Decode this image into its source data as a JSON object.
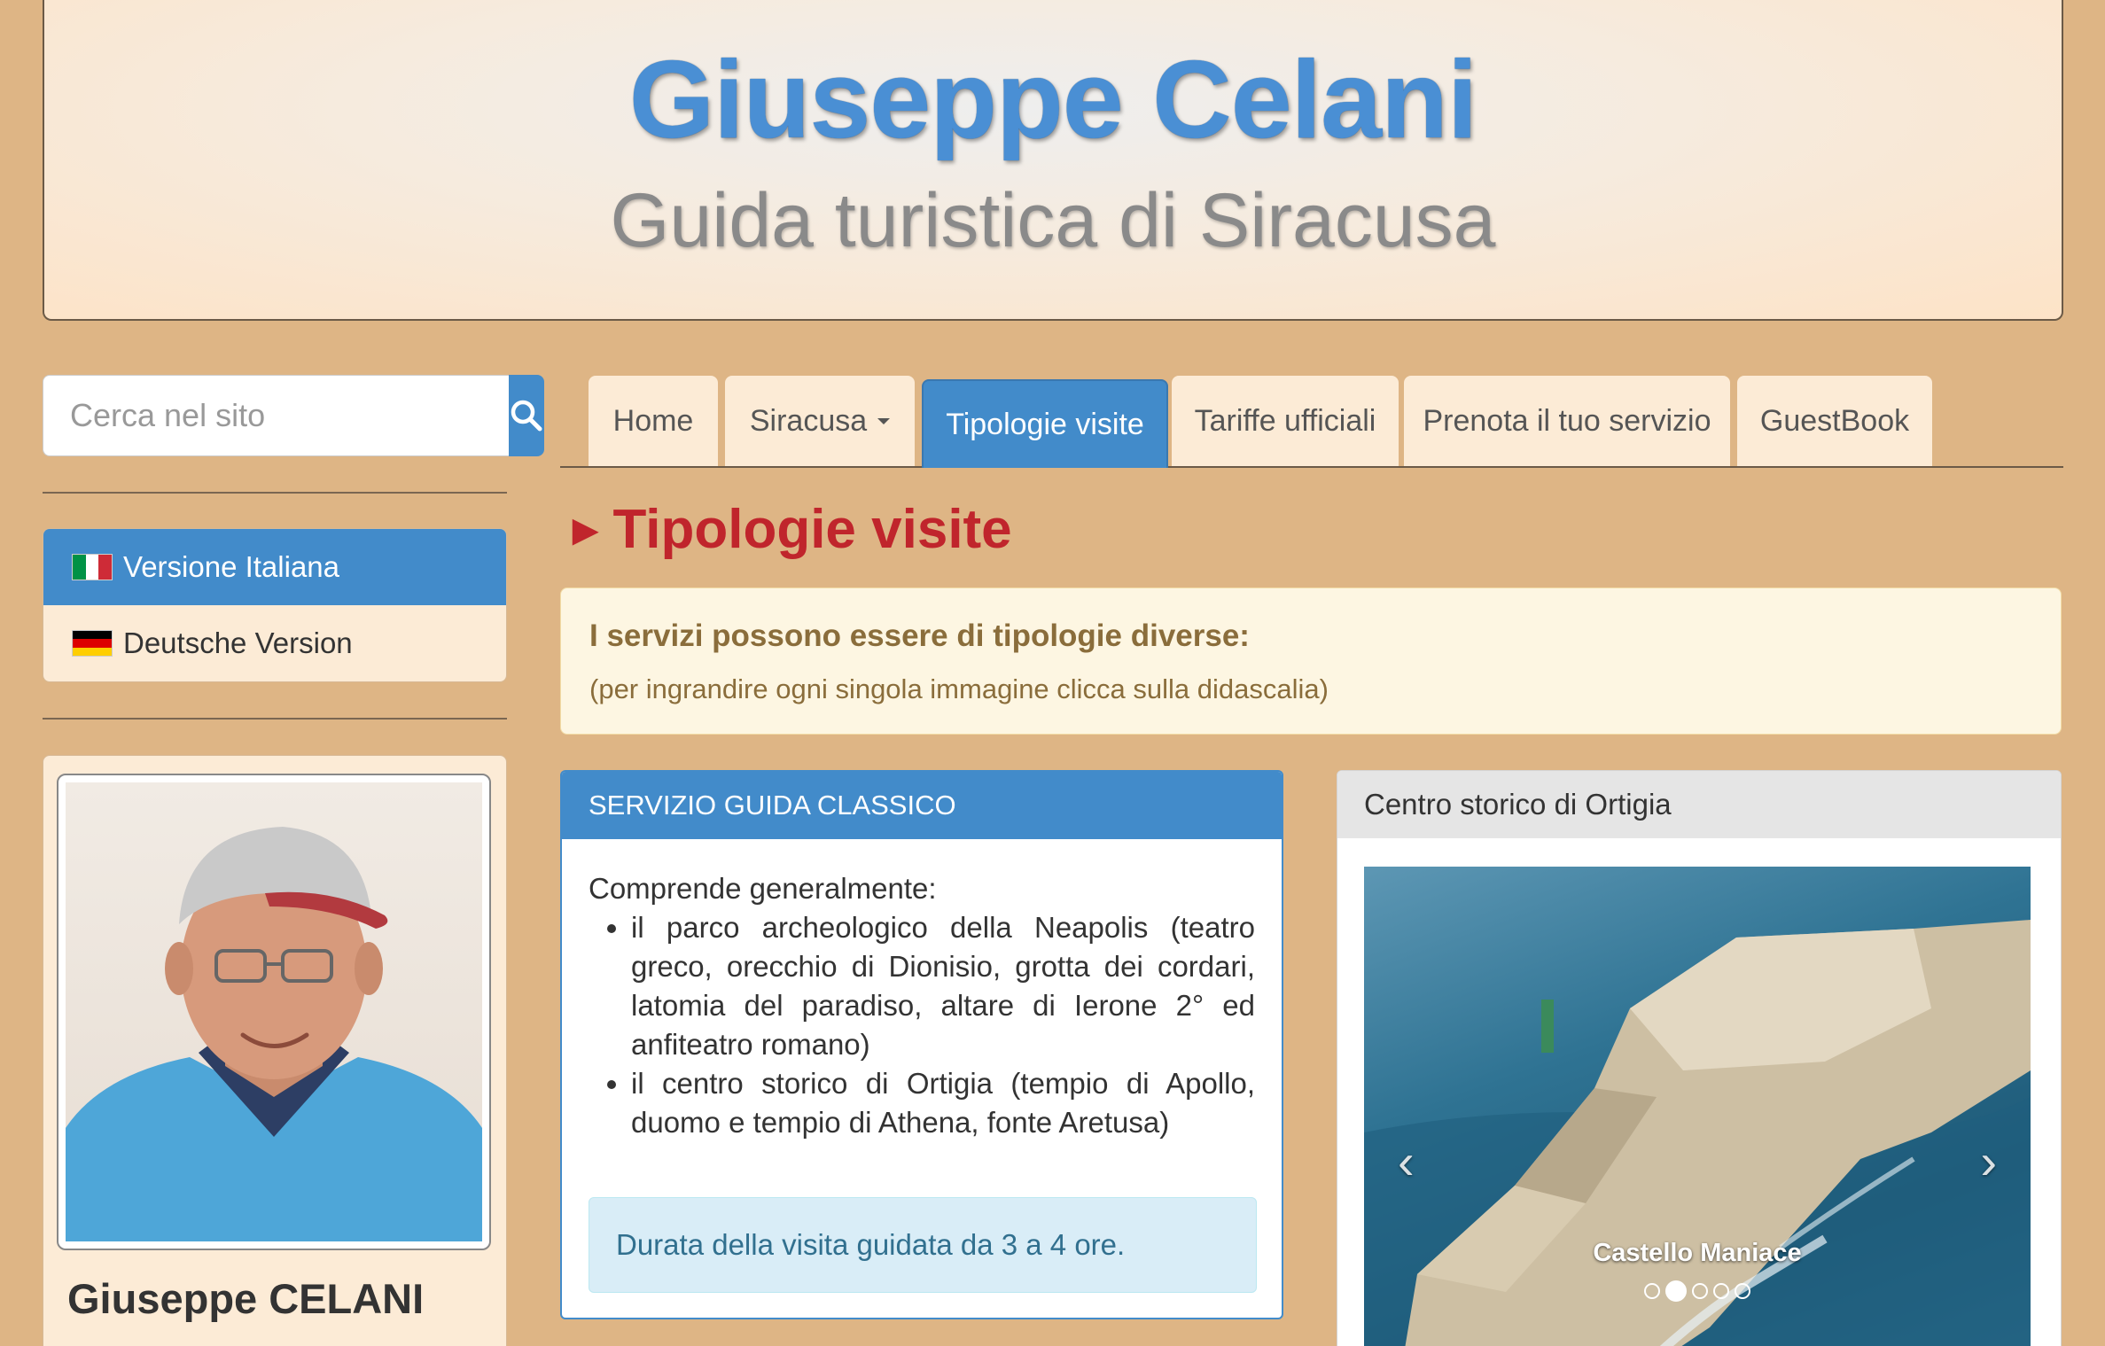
{
  "header": {
    "title": "Giuseppe Celani",
    "subtitle": "Guida turistica di Siracusa"
  },
  "sidebar": {
    "search": {
      "placeholder": "Cerca nel sito",
      "button_icon": "search-icon"
    },
    "languages": [
      {
        "label": "Versione Italiana",
        "flag": "italy-flag-icon",
        "active": true
      },
      {
        "label": "Deutsche Version",
        "flag": "germany-flag-icon",
        "active": false
      }
    ],
    "profile": {
      "name": "Giuseppe CELANI"
    }
  },
  "nav": {
    "tabs": [
      {
        "label": "Home",
        "active": false
      },
      {
        "label": "Siracusa",
        "active": false,
        "dropdown": true
      },
      {
        "label": "Tipologie visite",
        "active": true
      },
      {
        "label": "Tariffe ufficiali",
        "active": false
      },
      {
        "label": "Prenota il tuo servizio",
        "active": false
      },
      {
        "label": "GuestBook",
        "active": false
      }
    ]
  },
  "main": {
    "heading_arrow": "►",
    "heading": "Tipologie visite",
    "alert": {
      "title": "I servizi possono essere di tipologie diverse:",
      "subtitle": "(per ingrandire ogni singola immagine clicca sulla didascalia)"
    },
    "service_card": {
      "title": "SERVIZIO GUIDA CLASSICO",
      "intro": "Comprende generalmente:",
      "items": [
        "il parco archeologico della Neapolis (teatro greco, orecchio di Dionisio, grotta dei cordari, latomia del paradiso, altare di Ierone 2° ed anfiteatro romano)",
        "il centro storico di Ortigia (tempio di Apollo, duomo e tempio di Athena, fonte Aretusa)"
      ],
      "duration": "Durata della visita guidata da 3 a 4 ore."
    },
    "gallery_card": {
      "title": "Centro storico di Ortigia",
      "caption": "Castello Maniace",
      "slide_count": 5,
      "active_slide": 2
    }
  },
  "colors": {
    "background": "#deb585",
    "primary": "#428bca",
    "heading_red": "#c0252c",
    "panel": "#fcebd6"
  }
}
